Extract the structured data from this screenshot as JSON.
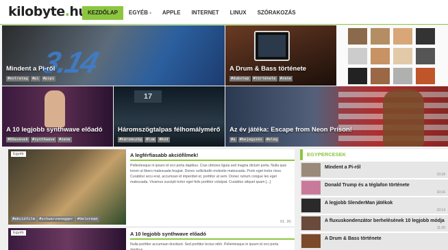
{
  "header": {
    "logo_main": "kilobyte",
    "logo_dot": ".",
    "logo_tld": "hu",
    "nav": [
      "KEZDŐLAP",
      "EGYÉB -",
      "APPLE",
      "INTERNET",
      "LINUX",
      "SZÓRAKOZÁS"
    ]
  },
  "tiles": [
    {
      "title": "Mindent a Pi-ről",
      "tags": [
        "#extratag",
        "#pi",
        "#pipi"
      ],
      "image_text": "3.14"
    },
    {
      "title": "A Drum & Bass története",
      "tags": [
        "#dubstep",
        "#története",
        "#zene"
      ]
    },
    {
      "title": "",
      "tags": []
    },
    {
      "title": "A 10 legjobb synthwave előadó",
      "tags": [
        "#80asévek",
        "#synthwave",
        "#zene"
      ]
    },
    {
      "title": "Háromszögtalpas félhomálymérő",
      "tags": [
        "#háromszög",
        "#lom",
        "#kód"
      ],
      "image_text": "17"
    },
    {
      "title": "Az év játéka: Escape from Neon Prison!",
      "tags": [
        "#a",
        "#bejegyzés",
        "#elég"
      ]
    }
  ],
  "cards": [
    {
      "category": "Egyéb",
      "title": "A legférfiasabb akciófilmek!",
      "text": "Pellentesque in ipsum id orci porta dapibus. Cras ultricies ligula sed magna dictum porta. Nulla quis lorem ut libero malesuada feugiat. Donec sollicitudin molestie malesuada. Proin eget tortor risus. Curabitur arcu erat, accumsan id imperdiet et, porttitor at sem. Donec rutrum congue leo eget malesuada. Vivamus suscipit tortor eget felis porttitor volutpat. Curabitur aliquet quam [...]",
      "date": "01. 20.",
      "tags": [
        "#akciófilm",
        "#schwarzenegger",
        "#delorean"
      ]
    },
    {
      "category": "Egyéb",
      "title": "A 10 legjobb synthwave előadó",
      "text": "Nulla porttitor accumsan tincidunt. Sed porttitor lectus nibh. Pellentesque in ipsum id orci porta dapibus.",
      "date": "",
      "tags": []
    }
  ],
  "sidebar": {
    "header": "EGYPERCESEK",
    "items": [
      {
        "title": "Mindent a Pi-ről",
        "time": "10:18"
      },
      {
        "title": "Donald Trump és a téglafon története",
        "time": "10:16"
      },
      {
        "title": "A legjobb SlenderMan játékok",
        "time": "10:14"
      },
      {
        "title": "A fluxuskondenzátor berhelésének 10 legjobb módja",
        "time": "11:20"
      },
      {
        "title": "A Drum & Bass története",
        "time": ""
      }
    ]
  },
  "colors": {
    "accent": "#8cc63f",
    "tag_bg": "#777777"
  }
}
